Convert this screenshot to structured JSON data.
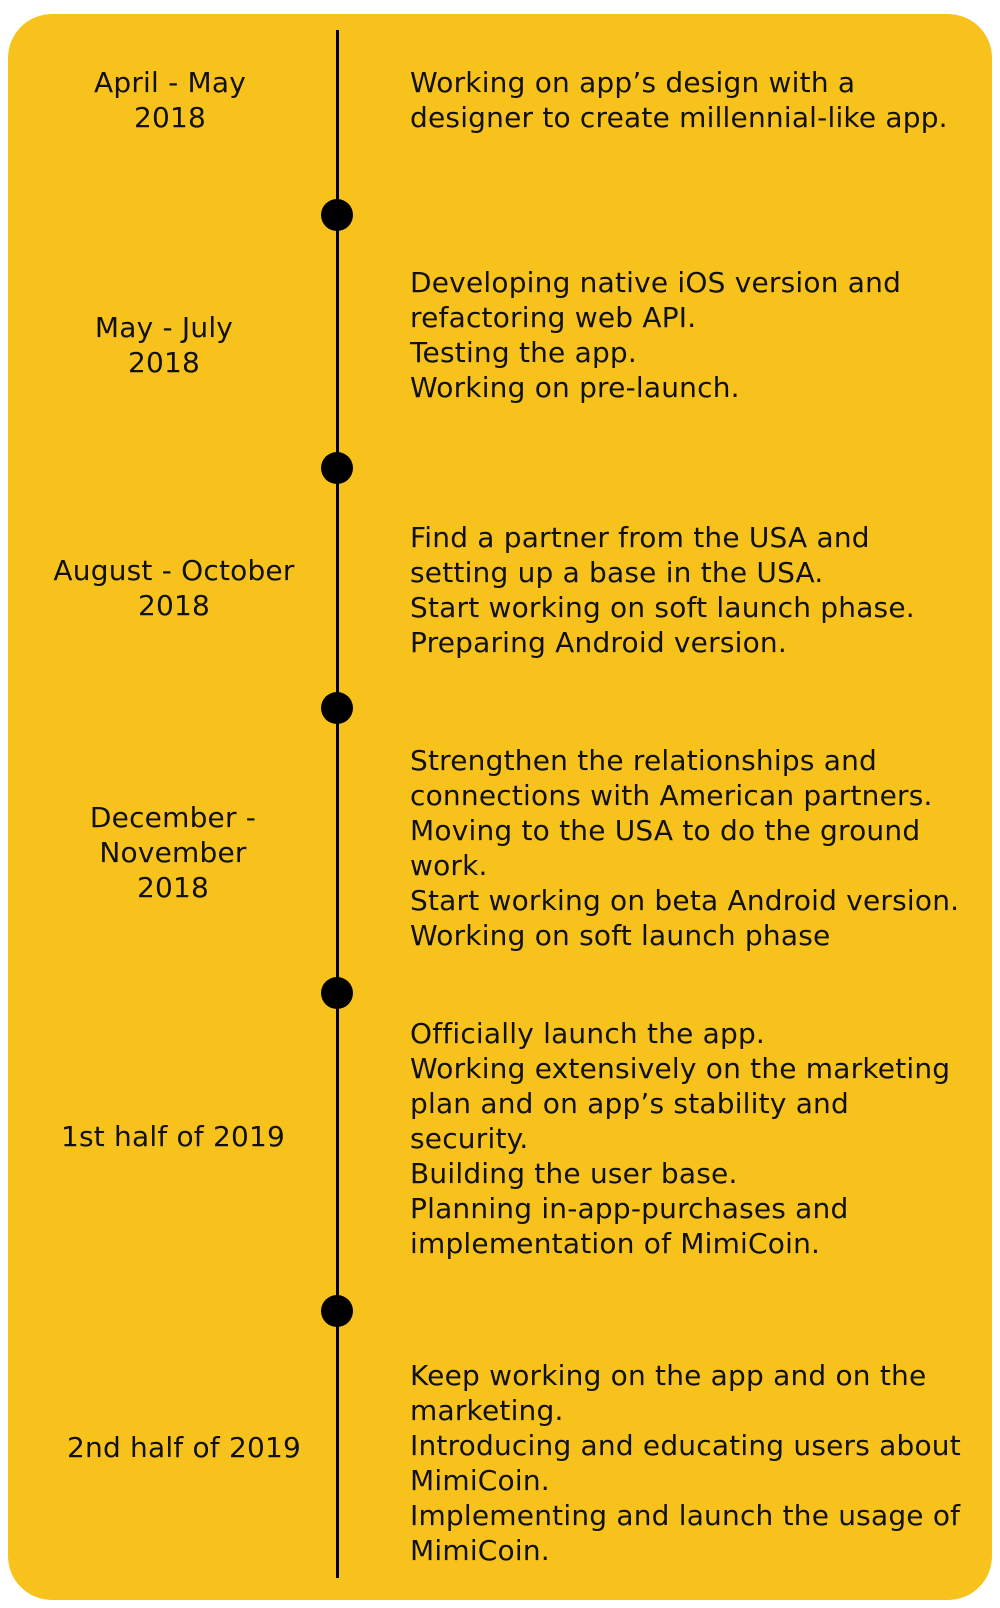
{
  "timeline": {
    "background_color": "#F8C21D",
    "line_color": "#000000",
    "entries": [
      {
        "period": [
          "April - May",
          "2018"
        ],
        "description": [
          "Working on app’s design with a",
          "designer to create millennial-like app."
        ]
      },
      {
        "period": [
          "May - July",
          "2018"
        ],
        "description": [
          "Developing native iOS version and",
          "refactoring web API.",
          "Testing the app.",
          "Working on pre-launch."
        ]
      },
      {
        "period": [
          "August - October",
          "2018"
        ],
        "description": [
          "Find a partner from the USA and",
          "setting up a base in the USA.",
          "Start working on soft launch phase.",
          "Preparing Android version."
        ]
      },
      {
        "period": [
          "December -",
          "November",
          "2018"
        ],
        "description": [
          "Strengthen the relationships and",
          "connections with American partners.",
          "Moving to the USA to do the ground",
          "work.",
          "Start working on beta Android version.",
          "Working on soft launch phase"
        ]
      },
      {
        "period": [
          "1st half of 2019"
        ],
        "description": [
          "Officially launch the app.",
          "Working extensively on the marketing",
          "plan and on app’s stability and",
          "security.",
          "Building the user base.",
          "Planning in-app-purchases and",
          "implementation of MimiCoin."
        ]
      },
      {
        "period": [
          "2nd half of 2019"
        ],
        "description": [
          "Keep working on the app and on the",
          "marketing.",
          "Introducing and educating users about",
          "MimiCoin.",
          "Implementing and launch the usage of",
          "MimiCoin."
        ]
      }
    ]
  }
}
